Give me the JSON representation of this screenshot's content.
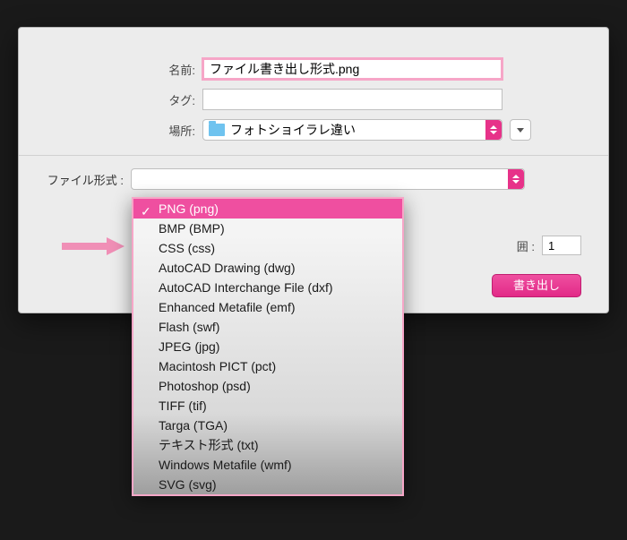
{
  "labels": {
    "name": "名前:",
    "tag": "タグ:",
    "location": "場所:",
    "filetype": "ファイル形式 :",
    "range": "囲 :"
  },
  "fields": {
    "name_value": "ファイル書き出し形式.png",
    "tag_value": "",
    "location_value": "フォトショイラレ違い",
    "range_value": "1"
  },
  "buttons": {
    "export": "書き出し"
  },
  "dropdown": {
    "items": [
      "PNG (png)",
      "BMP (BMP)",
      "CSS (css)",
      "AutoCAD Drawing (dwg)",
      "AutoCAD Interchange File (dxf)",
      "Enhanced Metafile (emf)",
      "Flash (swf)",
      "JPEG (jpg)",
      "Macintosh PICT (pct)",
      "Photoshop (psd)",
      "TIFF (tif)",
      "Targa (TGA)",
      "テキスト形式 (txt)",
      "Windows Metafile (wmf)",
      "SVG (svg)"
    ],
    "selected_index": 0
  },
  "colors": {
    "accent": "#e73289",
    "highlight_border": "#f6a6c7"
  }
}
